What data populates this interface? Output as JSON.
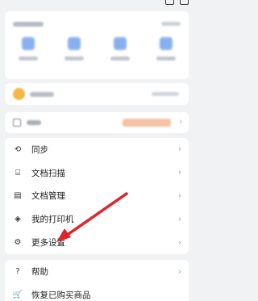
{
  "menu": {
    "items": [
      {
        "label": "同步",
        "icon": "sync-icon",
        "glyph": "⟲"
      },
      {
        "label": "文档扫描",
        "icon": "scan-icon",
        "glyph": "⌸"
      },
      {
        "label": "文档管理",
        "icon": "document-manage-icon",
        "glyph": "▤"
      },
      {
        "label": "我的打印机",
        "icon": "layers-icon",
        "glyph": "◈"
      },
      {
        "label": "更多设置",
        "icon": "settings-icon",
        "glyph": "⚙"
      }
    ],
    "chevron": "›"
  },
  "menu2": {
    "items": [
      {
        "label": "帮助",
        "icon": "help-icon",
        "glyph": "?"
      },
      {
        "label": "恢复已购买商品",
        "icon": "cart-icon",
        "glyph": "🛒"
      }
    ]
  },
  "annotation": {
    "arrow_color": "#e0262b"
  },
  "colors": {
    "background": "#f1f2f4",
    "card": "#ffffff",
    "accent": "#4a86e8"
  }
}
